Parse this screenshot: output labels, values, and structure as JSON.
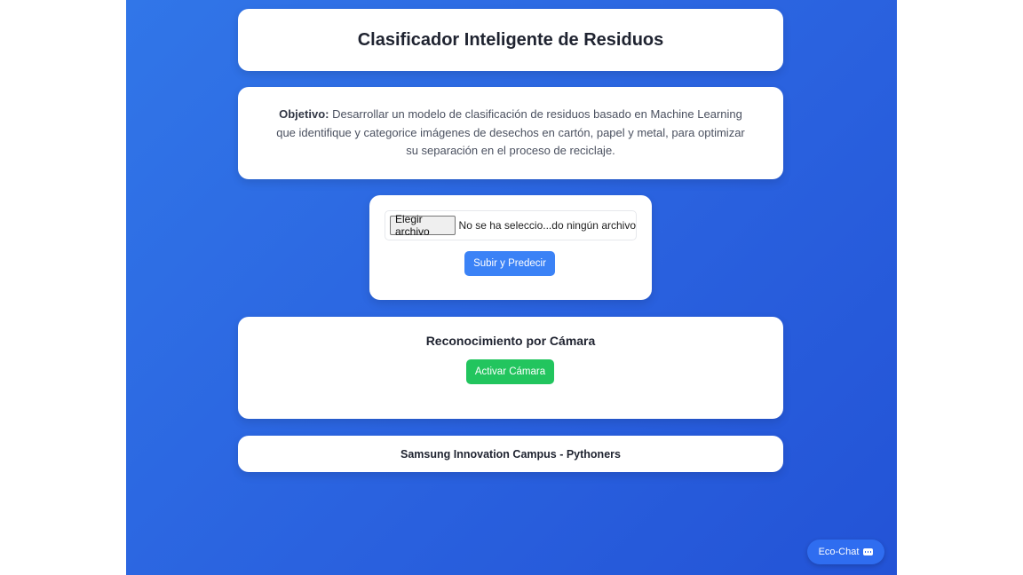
{
  "header": {
    "title": "Clasificador Inteligente de Residuos"
  },
  "objective": {
    "label": "Objetivo:",
    "text": " Desarrollar un modelo de clasificación de residuos basado en Machine Learning que identifique y categorice imágenes de desechos en cartón, papel y metal, para optimizar su separación en el proceso de reciclaje."
  },
  "upload": {
    "file_button_label": "Elegir archivo",
    "file_status": "No se ha seleccio...do ningún archivo",
    "submit_label": "Subir y Predecir"
  },
  "camera": {
    "title": "Reconocimiento por Cámara",
    "activate_label": "Activar Cámara"
  },
  "footer": {
    "text": "Samsung Innovation Campus - Pythoners"
  },
  "chat": {
    "label": "Eco-Chat",
    "icon": "chat-bubble-icon"
  },
  "colors": {
    "background_gradient_start": "#3176e8",
    "background_gradient_end": "#2353d6",
    "primary_button": "#3b82f6",
    "success_button": "#22c55e"
  }
}
